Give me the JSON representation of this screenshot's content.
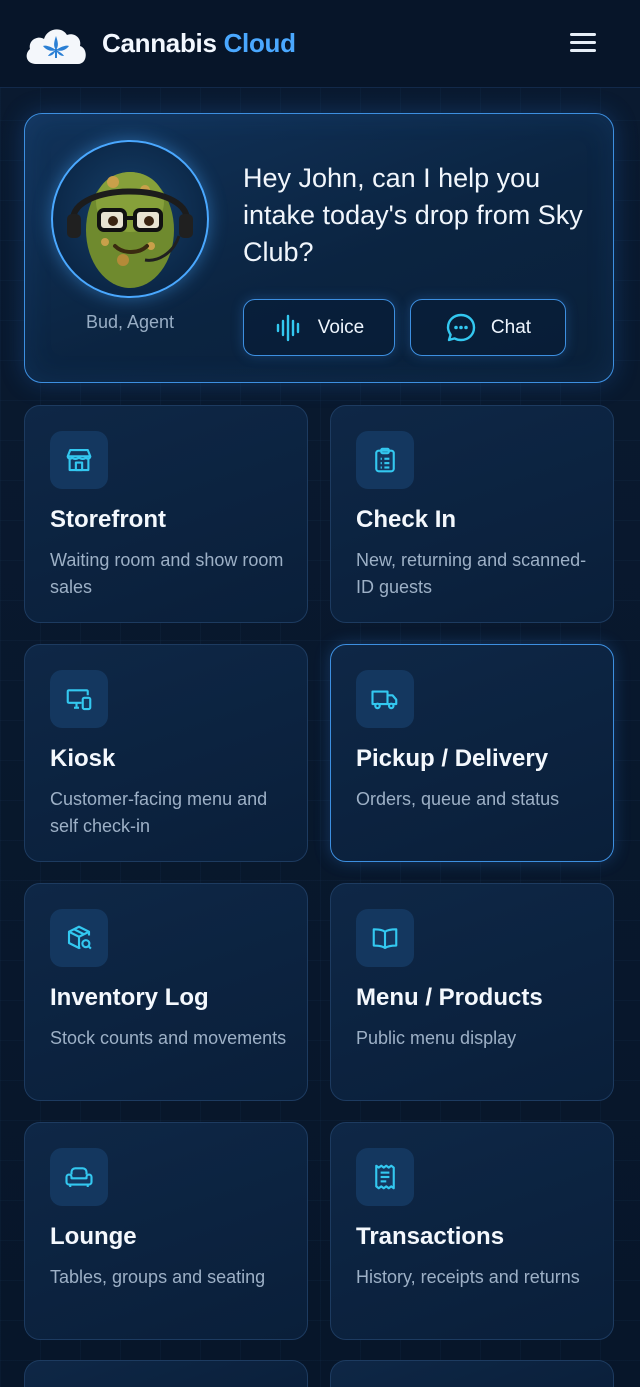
{
  "header": {
    "brand_part1": "Cannabis",
    "brand_part2": "Cloud",
    "logo_icon": "cloud-leaf-icon",
    "menu_icon": "hamburger-menu-icon",
    "accent_color": "#4aa8ff"
  },
  "agent": {
    "name_label": "Bud, Agent",
    "message": "Hey John, can I help you intake today's drop from Sky Club?",
    "voice_label": "Voice",
    "chat_label": "Chat",
    "voice_icon": "audio-waveform-icon",
    "chat_icon": "chat-bubble-icon"
  },
  "tiles": [
    {
      "title": "Storefront",
      "desc": "Waiting room and show room sales",
      "icon": "storefront-icon"
    },
    {
      "title": "Check In",
      "desc": "New, returning and scanned-ID guests",
      "icon": "clipboard-icon"
    },
    {
      "title": "Kiosk",
      "desc": "Customer-facing menu and self check-in",
      "icon": "kiosk-devices-icon"
    },
    {
      "title": "Pickup / Delivery",
      "desc": "Orders, queue and status",
      "icon": "delivery-truck-icon",
      "active": true
    },
    {
      "title": "Inventory Log",
      "desc": "Stock counts and movements",
      "icon": "package-search-icon"
    },
    {
      "title": "Menu / Products",
      "desc": "Public menu display",
      "icon": "open-book-icon"
    },
    {
      "title": "Lounge",
      "desc": "Tables, groups and seating",
      "icon": "armchair-icon"
    },
    {
      "title": "Transactions",
      "desc": "History, receipts and returns",
      "icon": "receipt-icon"
    }
  ]
}
